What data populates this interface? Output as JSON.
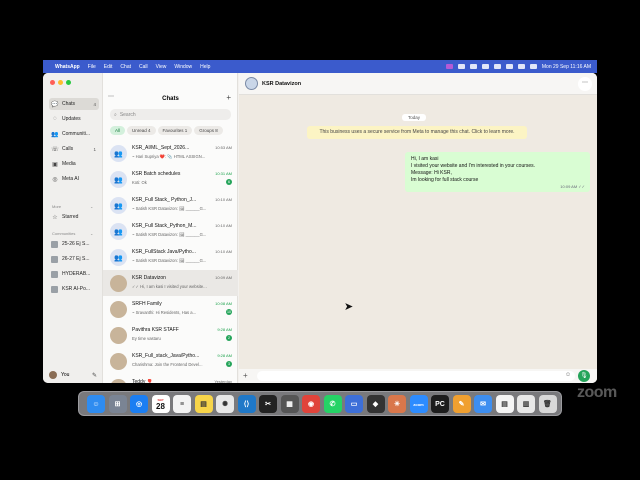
{
  "menubar": {
    "apple": "",
    "items": [
      "WhatsApp",
      "File",
      "Edit",
      "Chat",
      "Call",
      "View",
      "Window",
      "Help"
    ],
    "clock": "Mon 29 Sep  11:16 AM"
  },
  "nav": {
    "items": [
      {
        "icon": "chat-icon",
        "glyph": "💬",
        "label": "Chats",
        "badge": "4"
      },
      {
        "icon": "updates-icon",
        "glyph": "◌",
        "label": "Updates",
        "badge": ""
      },
      {
        "icon": "communities-icon",
        "glyph": "👥",
        "label": "Communiti...",
        "badge": ""
      },
      {
        "icon": "calls-icon",
        "glyph": "☏",
        "label": "Calls",
        "badge": "1"
      },
      {
        "icon": "media-icon",
        "glyph": "▣",
        "label": "Media",
        "badge": ""
      },
      {
        "icon": "meta-ai-icon",
        "glyph": "◎",
        "label": "Meta AI",
        "badge": ""
      }
    ],
    "more_label": "More",
    "starred_label": "Starred",
    "communities_label": "Communities",
    "communities": [
      "25-26 Ej S...",
      "26-27 Ej S...",
      "HYDERAB...",
      "KSR AI-Po..."
    ],
    "you_label": "You"
  },
  "list": {
    "title": "Chats",
    "search_placeholder": "Search",
    "filters": [
      "All",
      "Unread 4",
      "Favourites 1",
      "Groups 8"
    ],
    "chats": [
      {
        "name": "KSR_AI/ML_Sept_2026...",
        "time": "10:53 AM",
        "preview": "~ Hari Supriya ❤️: 📎 HTML ASSIGN...",
        "badge": "",
        "group": true
      },
      {
        "name": "KSR Batch schedules",
        "time": "10:31 AM",
        "preview": "Koti: Ok",
        "badge": "6",
        "group": true
      },
      {
        "name": "KSR_Full Stack_ Python_J...",
        "time": "10:10 AM",
        "preview": "~ Satish KSR Datavizon: 🖼 ______G...",
        "badge": "",
        "group": true
      },
      {
        "name": "KSR_Full Stack_Python_M...",
        "time": "10:10 AM",
        "preview": "~ Satish KSR Datavizon: 🖼 ______G...",
        "badge": "",
        "group": true
      },
      {
        "name": "KSR_FullStack Java/Pytho...",
        "time": "10:10 AM",
        "preview": "~ Satish KSR Datavizon: 🖼 ______G...",
        "badge": "",
        "group": true
      },
      {
        "name": "KSR Datavizon",
        "time": "10:09 AM",
        "preview": "✓✓ Hi, I am kasi I visited your website...",
        "badge": "",
        "group": false
      },
      {
        "name": "SRFH Family",
        "time": "10:08 AM",
        "preview": "~ Sravanthi: Hi Residents, Has a...",
        "badge": "10",
        "group": false
      },
      {
        "name": "Pavithra KSR STAFF",
        "time": "9:28 AM",
        "preview": "Ey time vastaru",
        "badge": "2",
        "group": false
      },
      {
        "name": "KSR_Full_stack_Java/Pytho...",
        "time": "9:28 AM",
        "preview": "Charishma: Join the Frontend Devel...",
        "badge": "3",
        "group": false
      },
      {
        "name": "Teddy 🎈",
        "time": "Yesterday",
        "preview": "",
        "badge": "",
        "group": false
      }
    ]
  },
  "conversation": {
    "name": "KSR Datavizon",
    "day": "Today",
    "system_message": "This business uses a secure service from Meta to manage this chat. Click to learn more.",
    "message_lines": [
      "Hi, I am kasi",
      "I visited your website and I'm interested in your courses.",
      "Message: Hi KSR,",
      "Im looking for full stack course"
    ],
    "message_time": "10:09 AM ✓✓"
  },
  "dock": {
    "apps": [
      {
        "name": "finder-icon",
        "color": "#2f8cf0",
        "glyph": "☺"
      },
      {
        "name": "launchpad-icon",
        "color": "#7a8494",
        "glyph": "⊞"
      },
      {
        "name": "safari-icon",
        "color": "#1b7ef2",
        "glyph": "◎"
      },
      {
        "name": "calendar-icon",
        "color": "#ffffff",
        "glyph": ""
      },
      {
        "name": "reminders-icon",
        "color": "#f3f3f3",
        "glyph": "≡"
      },
      {
        "name": "notes-icon",
        "color": "#f7d54a",
        "glyph": "▤"
      },
      {
        "name": "chatgpt-icon",
        "color": "#e8e8e8",
        "glyph": "✺"
      },
      {
        "name": "vscode-icon",
        "color": "#1f78c8",
        "glyph": "⟨⟩"
      },
      {
        "name": "capcut-icon",
        "color": "#222222",
        "glyph": "✂"
      },
      {
        "name": "screenshot-icon",
        "color": "#555555",
        "glyph": "▦"
      },
      {
        "name": "chrome-icon",
        "color": "#e0433a",
        "glyph": "◉"
      },
      {
        "name": "whatsapp-icon",
        "color": "#25d366",
        "glyph": "✆"
      },
      {
        "name": "screen-sharing-icon",
        "color": "#3d6fd8",
        "glyph": "▭"
      },
      {
        "name": "game-icon",
        "color": "#333333",
        "glyph": "◆"
      },
      {
        "name": "claude-icon",
        "color": "#d9774b",
        "glyph": "✳"
      },
      {
        "name": "zoom-icon",
        "color": "#2d8cff",
        "glyph": "zoom"
      },
      {
        "name": "pycharm-icon",
        "color": "#1d1d1d",
        "glyph": "PC"
      },
      {
        "name": "pages-icon",
        "color": "#f0a030",
        "glyph": "✎"
      },
      {
        "name": "mail-icon",
        "color": "#3d8ef0",
        "glyph": "✉"
      },
      {
        "name": "document-icon",
        "color": "#f5f5f5",
        "glyph": "▤"
      },
      {
        "name": "preview-icon",
        "color": "#e8e8e8",
        "glyph": "▥"
      },
      {
        "name": "trash-icon",
        "color": "#d8d8d8",
        "glyph": "🗑"
      }
    ],
    "calendar_month": "SEP",
    "calendar_day": "28"
  },
  "watermark": "zoom"
}
